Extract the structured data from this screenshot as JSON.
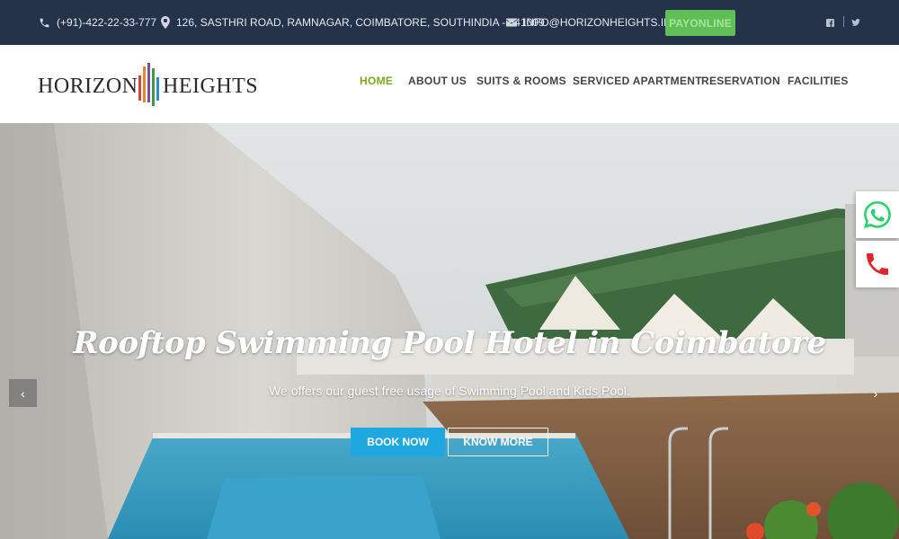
{
  "topbar": {
    "phone": "(+91)-422-22-33-777",
    "address": "126, SASTHRI ROAD, RAMNAGAR, COIMBATORE, SOUTHINDIA - 641009",
    "email": "INFO@HORIZONHEIGHTS.IN",
    "pay_label": "PAYONLINE",
    "social": [
      "facebook-icon",
      "twitter-icon"
    ]
  },
  "logo": {
    "left": "HORIZON",
    "right": "HEIGHTS"
  },
  "nav": {
    "items": [
      "HOME",
      "ABOUT US",
      "SUITS & ROOMS",
      "SERVICED APARTMENT",
      "RESERVATION",
      "FACILITIES"
    ],
    "active": "HOME"
  },
  "hero": {
    "title": "Rooftop Swimming Pool Hotel in Coimbatore",
    "subtitle": "We offers our guest free usage of Swimming Pool and Kids Pool.",
    "book_label": "BOOK NOW",
    "more_label": "KNOW MORE",
    "prev_icon": "‹",
    "next_icon": "›"
  },
  "floating": [
    "whatsapp-icon",
    "phone-icon"
  ],
  "colors": {
    "topbar": "#24324a",
    "accent_green": "#7aa91f",
    "pay_button": "#5fbf56",
    "book_button": "#1fa7df",
    "whatsapp": "#25d366",
    "phone": "#e0252b"
  }
}
